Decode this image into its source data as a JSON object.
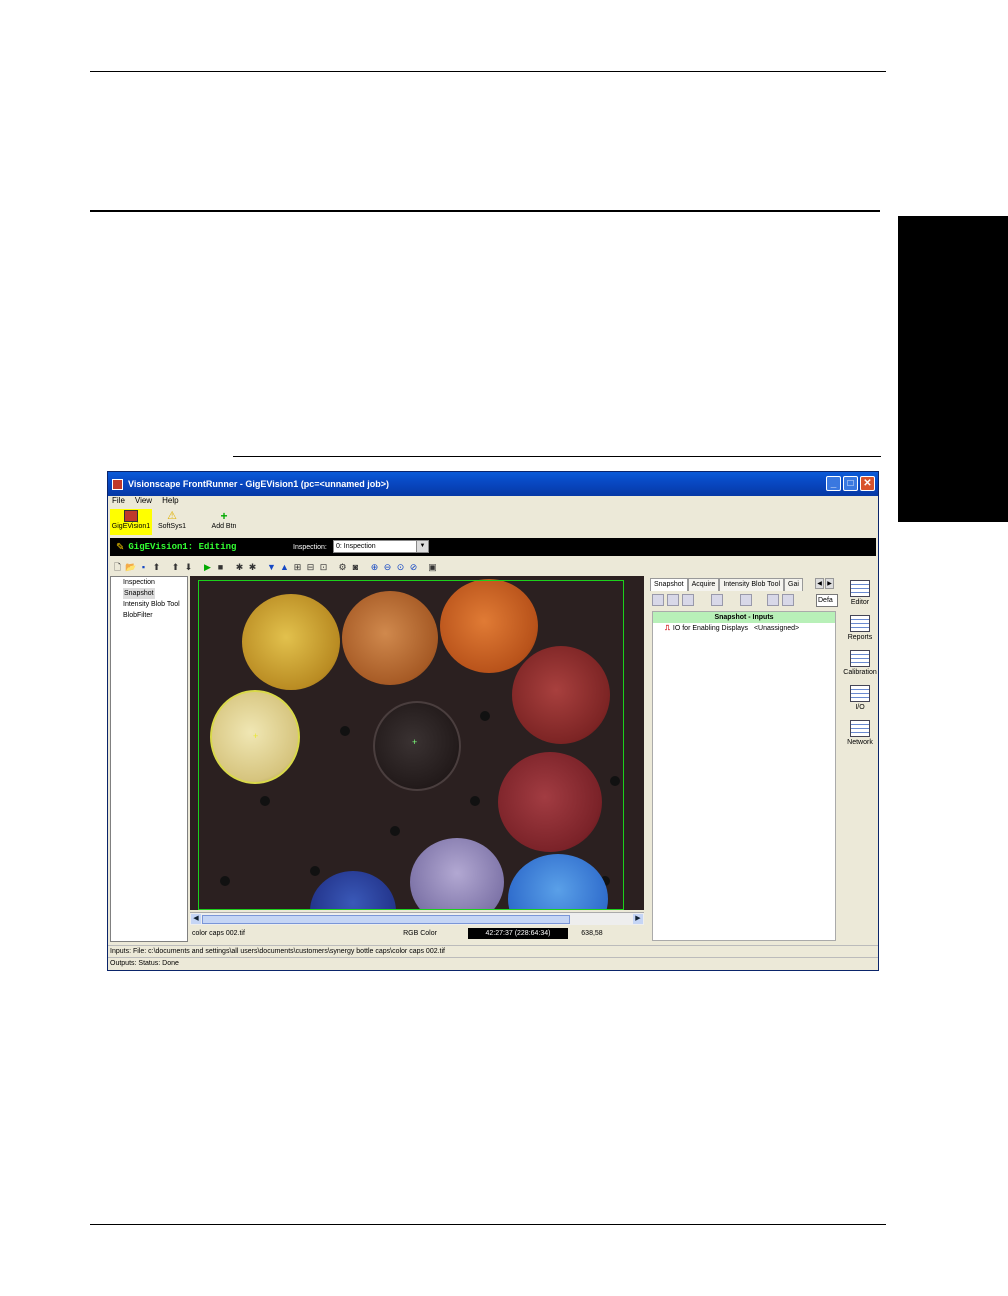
{
  "window": {
    "title": "Visionscape FrontRunner - GigEVision1 (pc=<unnamed job>)",
    "controls": [
      "_",
      "□",
      "✕"
    ]
  },
  "menu": [
    "File",
    "View",
    "Help"
  ],
  "devices": [
    {
      "label": "GigEVision1"
    },
    {
      "label": "SoftSys1"
    },
    {
      "label": "Add Btn"
    }
  ],
  "edit_bar": {
    "title": "GigEVision1: Editing",
    "inspection_label": "Inspection:",
    "inspection_value": "0: Inspection"
  },
  "tree": [
    "Inspection",
    "Snapshot",
    "Intensity Blob Tool",
    "BlobFilter"
  ],
  "image_status": {
    "file": "color caps 002.tif",
    "mode": "RGB Color",
    "pixel": "42:27:37 (228:64:34)",
    "coords": "638,58"
  },
  "right_panel": {
    "tabs": [
      "Snapshot",
      "Acquire",
      "Intensity Blob Tool",
      "Gai"
    ],
    "default_field": "Defa",
    "header": "Snapshot - Inputs",
    "row_label": "IO for Enabling Displays",
    "row_value": "<Unassigned>"
  },
  "side_buttons": [
    "Editor",
    "Reports",
    "Calibration",
    "I/O",
    "Network"
  ],
  "status": {
    "inputs": "Inputs: File: c:\\documents and settings\\all users\\documents\\customers\\synergy bottle caps\\color caps 002.tif",
    "outputs": "Outputs: Status: Done"
  }
}
